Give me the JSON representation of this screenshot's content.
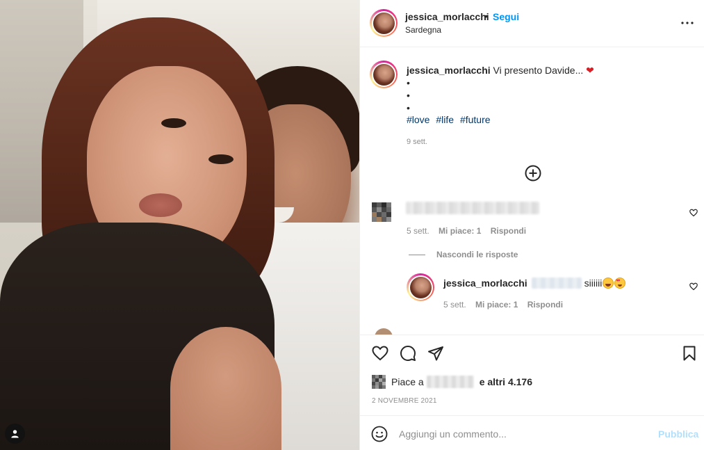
{
  "post": {
    "username": "jessica_morlacchi",
    "separator": "•",
    "follow_label": "Segui",
    "location": "Sardegna",
    "more_icon": "more-horizontal-icon"
  },
  "caption": {
    "username": "jessica_morlacchi",
    "text": "Vi presento Davide...",
    "heart_emoji": "❤",
    "dots": [
      "•",
      "•",
      "•"
    ],
    "hashtags": [
      "#love",
      "#life",
      "#future"
    ],
    "time": "9 sett."
  },
  "load_more_icon": "plus-circle-icon",
  "comments": [
    {
      "time": "5 sett.",
      "likes_label": "Mi piace: 1",
      "reply_label": "Rispondi",
      "hide_replies_label": "Nascondi le risposte",
      "replies": [
        {
          "username": "jessica_morlacchi",
          "text": "siiiiii",
          "emojis": [
            "laughing-emoji",
            "heart-eyes-emoji"
          ],
          "time": "5 sett.",
          "likes_label": "Mi piace: 1",
          "reply_label": "Rispondi"
        }
      ]
    }
  ],
  "actions": {
    "icons": [
      "heart-icon",
      "comment-icon",
      "share-icon",
      "bookmark-icon"
    ],
    "likes_prefix": "Piace a",
    "likes_suffix": "e altri 4.176",
    "date": "2 NOVEMBRE 2021"
  },
  "add_comment": {
    "placeholder": "Aggiungi un commento...",
    "publish_label": "Pubblica"
  },
  "colors": {
    "link_blue": "#0095f6",
    "hashtag_blue": "#00376b",
    "muted_gray": "#8e8e8e",
    "publish_disabled": "#b2dffc"
  }
}
